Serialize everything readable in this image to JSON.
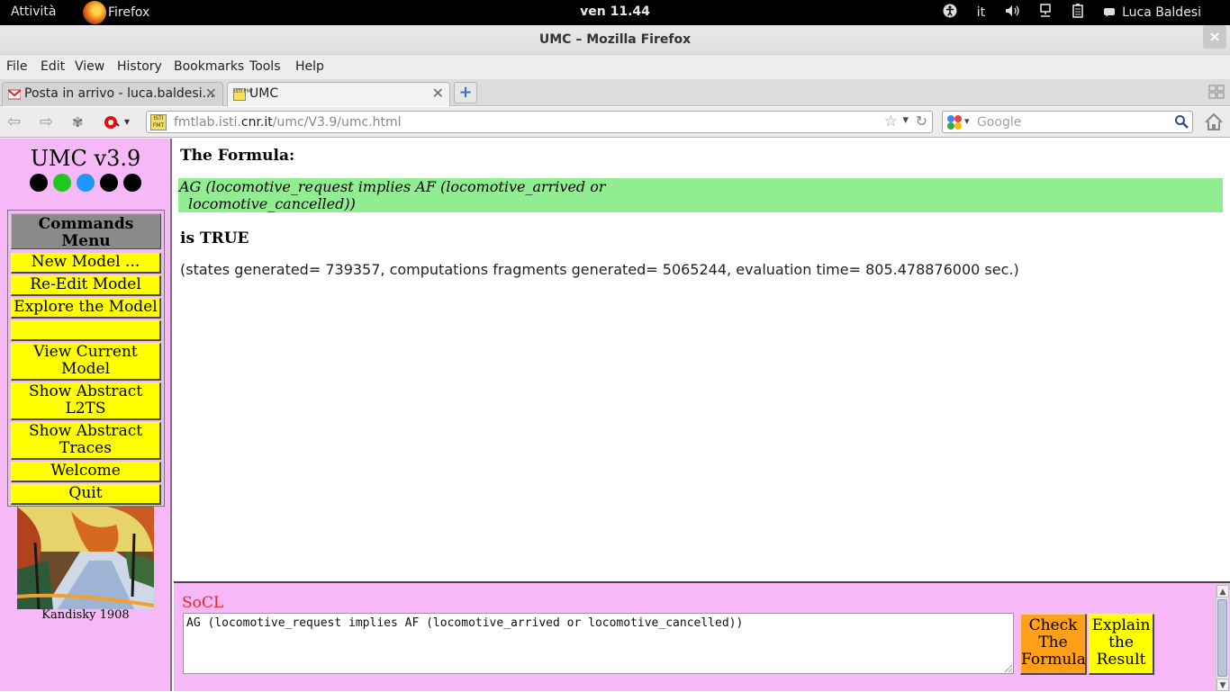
{
  "topbar": {
    "activities": "Attività",
    "app_name": "Firefox",
    "clock": "ven 11.44",
    "lang": "it",
    "user": "Luca Baldesi"
  },
  "window": {
    "title": "UMC – Mozilla Firefox"
  },
  "menubar": {
    "items": [
      "File",
      "Edit",
      "View",
      "History",
      "Bookmarks",
      "Tools",
      "Help"
    ]
  },
  "tabs": [
    {
      "label": "Posta in arrivo - luca.baldesi...",
      "active": false
    },
    {
      "label": "UMC",
      "active": true
    }
  ],
  "navbar": {
    "url_prefix": "fmtlab.isti.",
    "url_domain": "cnr.it",
    "url_path": "/umc/V3.9/umc.html",
    "search_placeholder": "Google",
    "favicon_text": "ISTI FMT"
  },
  "sidebar": {
    "title": "UMC v3.9",
    "dot_colors": [
      "#000000",
      "#1ec81e",
      "#1e96ff",
      "#000000",
      "#000000"
    ],
    "menu_header": "Commands Menu",
    "menu_items": [
      "New Model ...",
      "Re-Edit Model",
      "Explore the Model",
      "",
      "View Current Model",
      "Show Abstract L2TS",
      "Show Abstract Traces",
      "Welcome",
      "Quit"
    ],
    "caption": "Kandisky 1908"
  },
  "main": {
    "formula_label": "The Formula:",
    "formula_line1": "AG (locomotive_request implies AF (locomotive_arrived or",
    "formula_line2": "locomotive_cancelled))",
    "result": "is TRUE",
    "stats": "(states generated= 739357, computations fragments generated= 5065244, evaluation time= 805.478876000 sec.)"
  },
  "bottom": {
    "label": "SoCL",
    "formula_input": "AG (locomotive_request implies AF (locomotive_arrived or locomotive_cancelled))",
    "check_button": "Check The Formula",
    "explain_button": "Explain the Result"
  },
  "colors": {
    "sidebar_bg": "#f6b8f6",
    "button_yellow": "#ffff00",
    "button_orange": "#ff9f1a",
    "formula_green": "#90ee90",
    "socl_red": "#e8232b"
  }
}
